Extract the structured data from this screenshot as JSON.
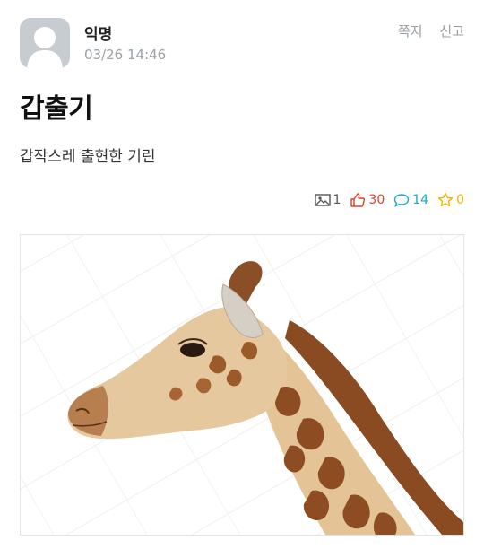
{
  "post": {
    "author": "익명",
    "timestamp": "03/26 14:46",
    "title": "갑출기",
    "body": "갑작스레 출현한 기린"
  },
  "actions": {
    "message_label": "쪽지",
    "report_label": "신고"
  },
  "stats": {
    "images": "1",
    "likes": "30",
    "comments": "14",
    "scraps": "0",
    "colors": {
      "images": "#555555",
      "likes": "#e0402a",
      "comments": "#18a8c8",
      "scraps": "#f0b400"
    }
  },
  "icons": [
    "avatar-placeholder",
    "image-icon",
    "thumbs-up-icon",
    "comment-icon",
    "star-icon"
  ],
  "image": {
    "subject": "giraffe-photo",
    "has_watermark": true
  }
}
